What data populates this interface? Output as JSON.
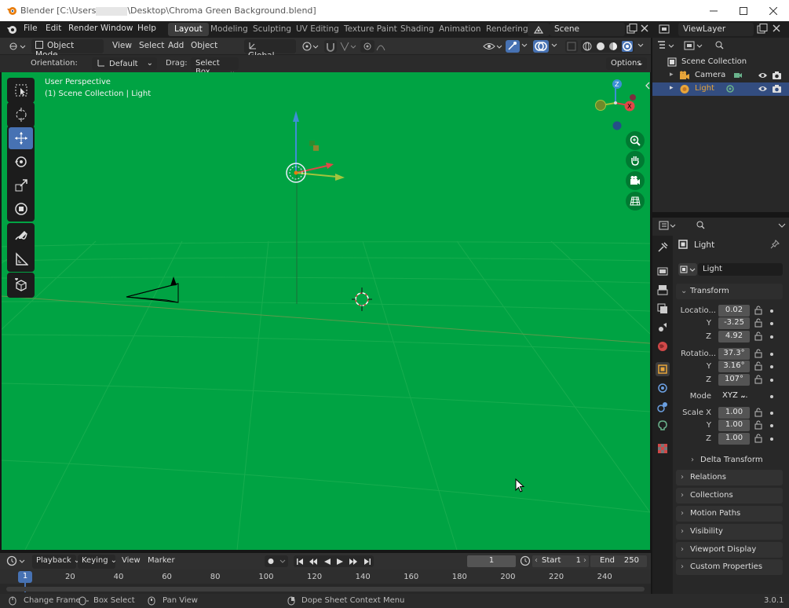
{
  "titlebar": {
    "app": "Blender [C:\\Users",
    "path_suffix": "\\Desktop\\Chroma Green Background.blend]"
  },
  "topmenu": {
    "items": [
      "File",
      "Edit",
      "Render",
      "Window",
      "Help"
    ]
  },
  "workspaces": [
    "Layout",
    "Modeling",
    "Sculpting",
    "UV Editing",
    "Texture Paint",
    "Shading",
    "Animation",
    "Rendering"
  ],
  "scene": {
    "name": "Scene"
  },
  "viewlayer": {
    "name": "ViewLayer"
  },
  "header": {
    "mode": "Object Mode",
    "menus": [
      "View",
      "Select",
      "Add",
      "Object"
    ],
    "transform_orientation": "Global"
  },
  "toolsettings": {
    "orientation_label": "Orientation:",
    "orientation_value": "Default",
    "drag_label": "Drag:",
    "drag_value": "Select Box",
    "options": "Options"
  },
  "viewport": {
    "perspective": "User Perspective",
    "collection_info": "(1) Scene Collection | Light",
    "bg_color": "#00a343"
  },
  "outliner": {
    "root": "Scene Collection",
    "items": [
      {
        "name": "Camera",
        "selected": false
      },
      {
        "name": "Light",
        "selected": true
      }
    ]
  },
  "properties": {
    "object_name": "Light",
    "data_name": "Light",
    "transform_title": "Transform",
    "location_label": "Locatio...",
    "location": {
      "x": "0.02",
      "y": "-3.25",
      "z": "4.92"
    },
    "rotation_label": "Rotatio...",
    "rotation": {
      "x": "37.3°",
      "y": "3.16°",
      "z": "107°"
    },
    "mode_label": "Mode",
    "mode": "XYZ ...",
    "scale_label": "Scale X",
    "scale": {
      "x": "1.00",
      "y": "1.00",
      "z": "1.00"
    },
    "axis_y": "Y",
    "axis_z": "Z",
    "delta_transform": "Delta Transform",
    "panels": [
      "Relations",
      "Collections",
      "Motion Paths",
      "Visibility",
      "Viewport Display",
      "Custom Properties"
    ]
  },
  "timeline": {
    "menus": [
      "Playback",
      "Keying",
      "View",
      "Marker"
    ],
    "current_frame": "1",
    "start_label": "Start",
    "start_value": "1",
    "end_label": "End",
    "end_value": "250",
    "ticks": [
      "20",
      "40",
      "60",
      "80",
      "100",
      "120",
      "140",
      "160",
      "180",
      "200",
      "220",
      "240"
    ],
    "playhead": "1"
  },
  "statusbar": {
    "change_frame": "Change Frame",
    "box_select": "Box Select",
    "pan_view": "Pan View",
    "context_menu": "Dope Sheet Context Menu",
    "version": "3.0.1"
  }
}
